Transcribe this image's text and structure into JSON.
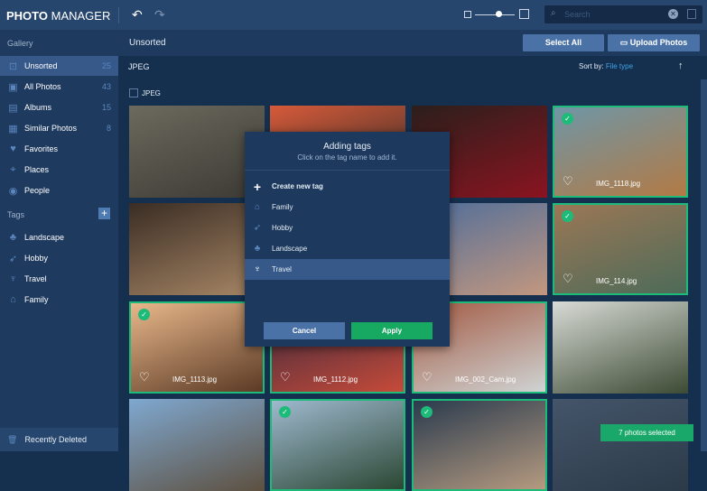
{
  "app": {
    "logo_bold": "PHOTO",
    "logo_rest": " MANAGER"
  },
  "toolbar": {
    "undo": "↶",
    "redo": "↷",
    "search_placeholder": "Search"
  },
  "sidebar": {
    "gallery_label": "Gallery",
    "items": [
      {
        "label": "Unsorted",
        "count": "25",
        "icon": "unsorted-icon"
      },
      {
        "label": "All Photos",
        "count": "43",
        "icon": "photos-icon"
      },
      {
        "label": "Albums",
        "count": "15",
        "icon": "albums-icon"
      },
      {
        "label": "Similar Photos",
        "count": "8",
        "icon": "similar-icon"
      },
      {
        "label": "Favorites",
        "count": "",
        "icon": "heart-icon"
      },
      {
        "label": "Places",
        "count": "",
        "icon": "pin-icon"
      },
      {
        "label": "People",
        "count": "",
        "icon": "people-icon"
      }
    ],
    "tags_label": "Tags",
    "tags": [
      {
        "label": "Landscape"
      },
      {
        "label": "Hobby"
      },
      {
        "label": "Travel"
      },
      {
        "label": "Family"
      }
    ],
    "recently_deleted": "Recently Deleted"
  },
  "main": {
    "title": "Unsorted",
    "select_all": "Select All",
    "upload": "Upload Photos",
    "group": "JPEG",
    "sort_label": "Sort by:",
    "sort_value": "File type",
    "group_checkbox": "JPEG"
  },
  "photos": [
    {
      "name": "",
      "selected": false,
      "c": "#6b6a5e,#3c3a33"
    },
    {
      "name": "",
      "selected": false,
      "c": "#d65a3a,#2b2a26"
    },
    {
      "name": "",
      "selected": false,
      "c": "#2b1f1c,#8a1420"
    },
    {
      "name": "IMG_1118.jpg",
      "selected": true,
      "c": "#6f96a6,#b27a45"
    },
    {
      "name": "",
      "selected": false,
      "c": "#3a2d24,#a88766"
    },
    {
      "name": "",
      "selected": false,
      "c": "#2f3c5c,#6b5f6e"
    },
    {
      "name": "",
      "selected": false,
      "c": "#4e6d9a,#c2977f"
    },
    {
      "name": "IMG_114.jpg",
      "selected": true,
      "c": "#9b7756,#4d6b58"
    },
    {
      "name": "IMG_1113.jpg",
      "selected": true,
      "c": "#e8b78a,#5b3a25"
    },
    {
      "name": "IMG_1112.jpg",
      "selected": true,
      "c": "#3a2a3c,#c64a3a"
    },
    {
      "name": "IMG_002_Cam.jpg",
      "selected": true,
      "c": "#a35b44,#cfd3d3"
    },
    {
      "name": "",
      "selected": false,
      "c": "#d8dbd6,#3c4a33"
    },
    {
      "name": "",
      "selected": false,
      "c": "#7fa8d0,#5d5040"
    },
    {
      "name": "",
      "selected": true,
      "c": "#9fb9cf,#2b4733"
    },
    {
      "name": "",
      "selected": true,
      "c": "#2a3b4e,#b59a80"
    },
    {
      "name": "",
      "selected": false,
      "c": "#45556a,#2b3a48"
    }
  ],
  "modal": {
    "title": "Adding tags",
    "subtitle": "Click on the tag name to add it.",
    "create": "Create new tag",
    "tags": [
      {
        "label": "Family",
        "icon": "house-icon"
      },
      {
        "label": "Hobby",
        "icon": "rocket-icon"
      },
      {
        "label": "Landscape",
        "icon": "trees-icon"
      },
      {
        "label": "Travel",
        "icon": "palm-icon"
      }
    ],
    "cancel": "Cancel",
    "apply": "Apply"
  },
  "toast": "7 photos selected",
  "colors": {
    "accent": "#1dbb7a",
    "primary": "#4a72a6"
  }
}
